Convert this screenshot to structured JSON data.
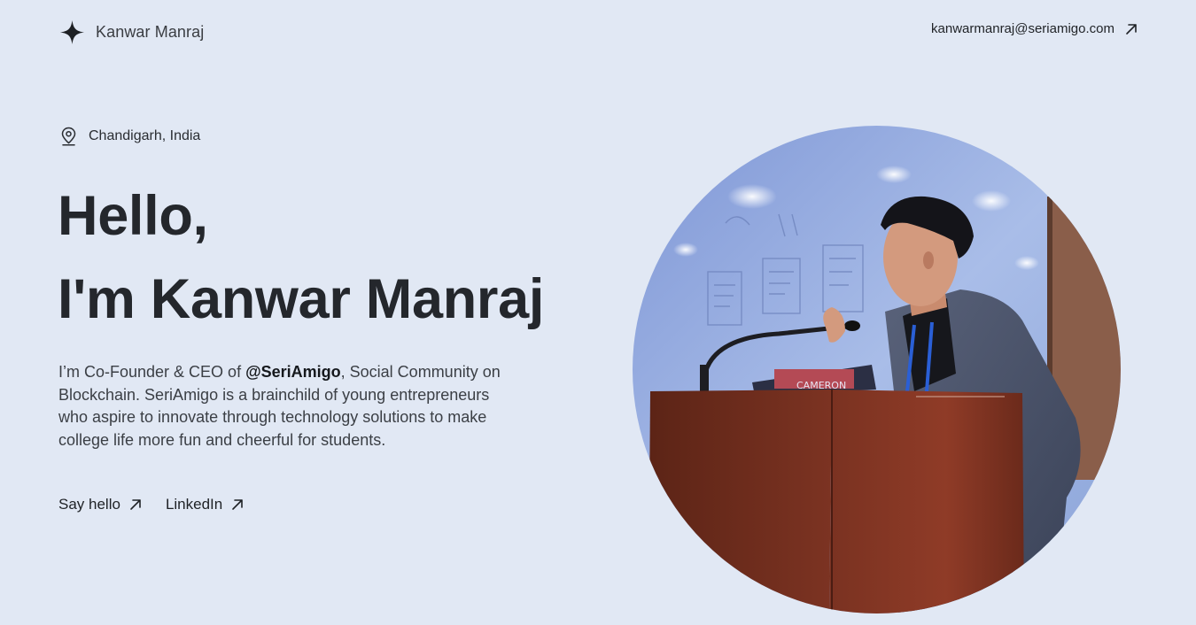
{
  "header": {
    "brand_icon": "four-point-star-icon",
    "brand_name": "Kanwar Manraj",
    "email": "kanwarmanraj@seriamigo.com",
    "email_icon": "arrow-up-right-icon"
  },
  "hero": {
    "location_icon": "map-pin-icon",
    "location": "Chandigarh, India",
    "greeting_line1": "Hello,",
    "greeting_line2": "I'm Kanwar Manraj",
    "intro_prefix": "I’m Co-Founder & CEO of ",
    "intro_handle": "@SeriAmigo",
    "intro_suffix": ", Social Community on Blockchain. SeriAmigo is a brainchild of young entrepreneurs who aspire to innovate through technology solutions to make college life more fun and cheerful for students.",
    "cta_say_hello": "Say hello",
    "cta_linkedin": "LinkedIn"
  },
  "portrait": {
    "description_icon": "speaker-at-podium-photo",
    "podium_label": "CAMERON"
  },
  "colors": {
    "background": "#e1e8f4",
    "text": "#23262b",
    "body_text": "#3b3f45"
  }
}
